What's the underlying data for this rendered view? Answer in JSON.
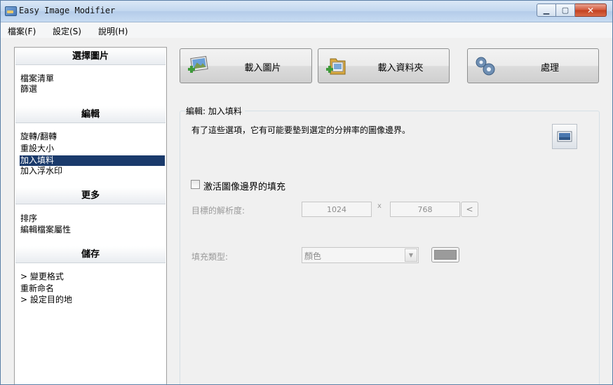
{
  "window": {
    "title": "Easy Image Modifier"
  },
  "menu": [
    "檔案(F)",
    "設定(S)",
    "說明(H)"
  ],
  "sidebar": {
    "sections": [
      {
        "title": "選擇圖片",
        "items": [
          "檔案清單",
          "篩選"
        ]
      },
      {
        "title": "編輯",
        "items": [
          "旋轉/翻轉",
          "重設大小",
          "加入填料",
          "加入浮水印"
        ]
      },
      {
        "title": "更多",
        "items": [
          "排序",
          "編輯檔案屬性"
        ]
      },
      {
        "title": "儲存",
        "items": [
          "> 變更格式",
          "重新命名",
          "> 設定目的地"
        ]
      }
    ],
    "selected": "加入填料"
  },
  "toolbar": {
    "load_images": "載入圖片",
    "load_folder": "載入資料夾",
    "process": "處理"
  },
  "panel": {
    "title": "編輯: 加入填料",
    "description": "有了這些選項，它有可能要墊到選定的分辨率的圖像邊界。",
    "enable_label": "激活圖像邊界的填充",
    "enable_checked": false,
    "resolution_label": "目標的解析度:",
    "width": "1024",
    "separator": "x",
    "height": "768",
    "small_button": "<",
    "fill_type_label": "填充類型:",
    "fill_type_value": "顏色",
    "fill_color": "#9b9b9b"
  },
  "icons": {
    "app": "app-icon",
    "load_images": "add-image-icon",
    "load_folder": "add-folder-icon",
    "process": "gears-icon",
    "preview": "image-preview-icon"
  }
}
